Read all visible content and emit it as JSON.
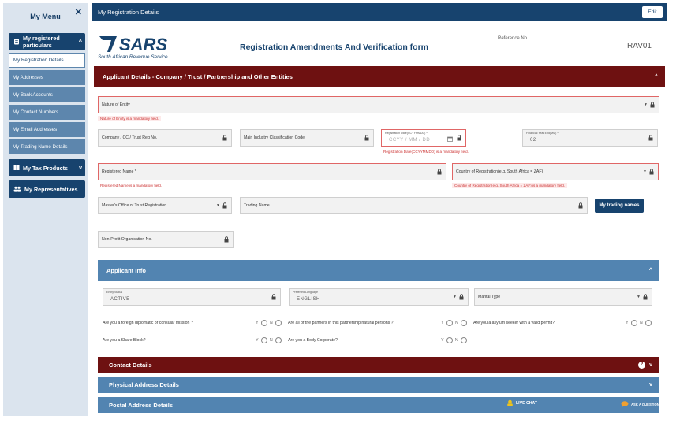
{
  "sidebar": {
    "title": "My Menu",
    "close_glyph": "✕",
    "registered": {
      "label": "My registered particulars",
      "chevron": "^"
    },
    "items": [
      {
        "label": "My Registration Details"
      },
      {
        "label": "My Addresses"
      },
      {
        "label": "My Bank Accounts"
      },
      {
        "label": "My Contact Numbers"
      },
      {
        "label": "My Email Addresses"
      },
      {
        "label": "My Trading Name Details"
      }
    ],
    "tax_products": {
      "label": "My Tax Products",
      "chevron": "v"
    },
    "representatives": {
      "label": "My Representatives"
    }
  },
  "topbar": {
    "title": "My Registration Details",
    "edit_label": "Edit"
  },
  "header": {
    "logo_text": "SARS",
    "logo_sub": "South African Revenue Service",
    "form_title": "Registration Amendments And Verification form",
    "ref_label": "Reference No.",
    "ref_value": "RAV01"
  },
  "applicant_details": {
    "title": "Applicant Details - Company / Trust / Partnership and Other Entities",
    "chevron": "^",
    "nature_of_entity": {
      "label": "Nature of Entity",
      "error": "Nature of Entity is a mandatory field."
    },
    "company_reg_no": {
      "label": "Company / CC / Trust Reg No."
    },
    "main_industry": {
      "label": "Main Industry Classification Code"
    },
    "registration_date": {
      "label": "Registration Date(CCYYMMDD) *",
      "placeholder": "CCYY  /  MM  /  DD",
      "error": "Registration Date(CCYYMMDD) is a mandatory field."
    },
    "financial_year_end": {
      "label": "Financial Year End(MM) *",
      "value": "02"
    },
    "registered_name": {
      "label": "Registered Name *",
      "error": "Registered Name is a mandatory field."
    },
    "country_of_registration": {
      "label": "Country of Registration(e.g. South Africa = ZAF)",
      "error": "Country of Registration(e.g. South Africa = ZAF) is a mandatory field."
    },
    "masters_office": {
      "label": "Master's Office of Trust Registration"
    },
    "trading_name": {
      "label": "Trading Name"
    },
    "trading_button": "My trading names",
    "npo_no": {
      "label": "Non-Profit Organisation No."
    }
  },
  "applicant_info": {
    "title": "Applicant Info",
    "chevron": "^",
    "entity_status": {
      "label": "Entity Status",
      "value": "ACTIVE"
    },
    "preferred_language": {
      "label": "Preferred Language",
      "value": "ENGLISH"
    },
    "marital_type": {
      "label": "Marital Type"
    },
    "questions": [
      {
        "text": "Are you a foreign diplomatic or consular mission ?"
      },
      {
        "text": "Are all of the partners in this partnership natural persons ?"
      },
      {
        "text": "Are you a asylum seeker with a valid permit?"
      },
      {
        "text": "Are you a Share Block?"
      },
      {
        "text": "Are you a Body Corporate?"
      }
    ],
    "yes_label": "Y",
    "no_label": "N"
  },
  "contact_details": {
    "title": "Contact Details",
    "chevron": "v",
    "info_glyph": "?"
  },
  "physical_address": {
    "title": "Physical Address Details",
    "chevron": "v"
  },
  "postal_address": {
    "title": "Postal Address Details"
  },
  "live_chat": {
    "label": "LIVE CHAT"
  },
  "ask_question": {
    "label": "ASK A QUESTION"
  },
  "colors": {
    "navy": "#17436e",
    "maroon": "#6e1111",
    "steel": "#5284b1",
    "error": "#e06666"
  }
}
